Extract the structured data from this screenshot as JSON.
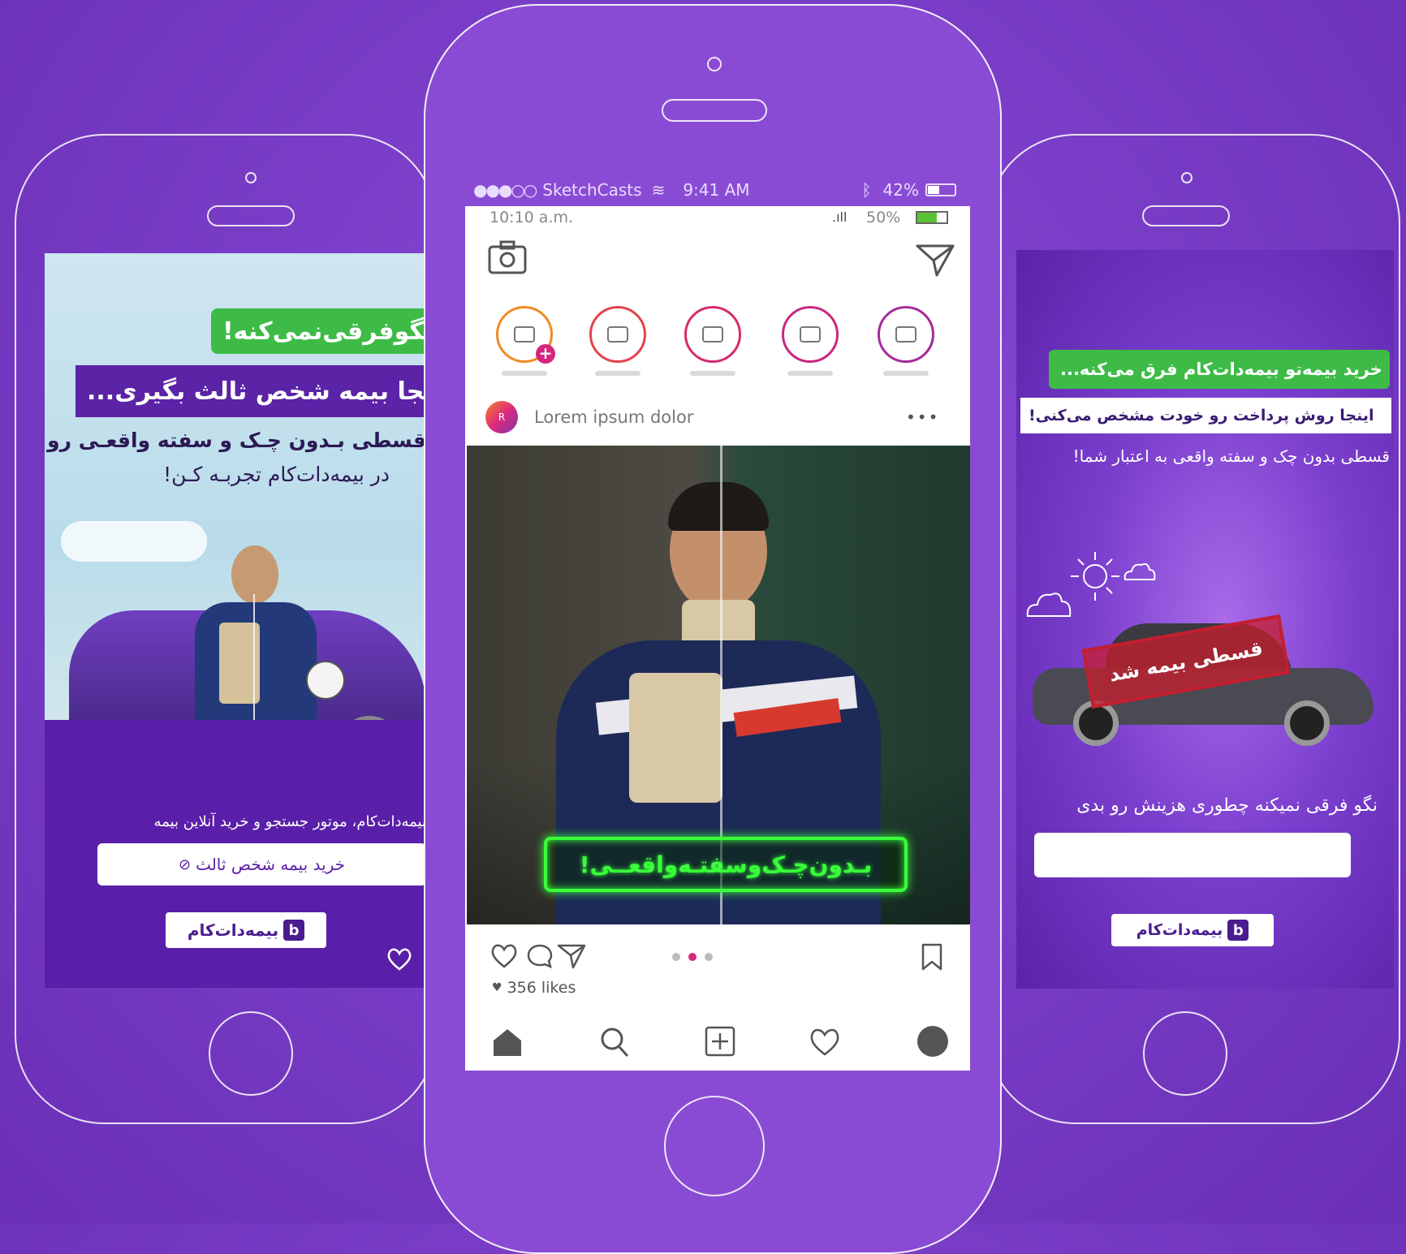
{
  "colors": {
    "background": "#7a3ec8",
    "accent_green": "#3dbb46",
    "accent_purple": "#5b23a6",
    "neon_green": "#39ff3a",
    "like_red": "#d6267d"
  },
  "left": {
    "green_headline": "نگوفرقی‌نمی‌کنه!",
    "purple_headline": "از کجا بیمه شخص ثالث بگیری...",
    "body_line1": "قسطی بـدون چـک و سفته واقعـی رو",
    "body_line2": "در بیمه‌دات‌کام تجربـه کـن!",
    "footer_text": "بیمه‌دات‌کام، موتور جستجو و خرید آنلاین بیمه",
    "cta": "خرید بیمه شخص ثالث",
    "logo": "بیمه‌دات‌کام",
    "logo_mark": "b",
    "heart_icon": "heart-icon"
  },
  "center": {
    "status_bar": {
      "carrier": "SketchCasts",
      "signal": "●●●○○",
      "time": "9:41 AM",
      "battery": "42%"
    },
    "inner_status": {
      "time": "10:10 a.m.",
      "battery": "50%"
    },
    "stories": [
      {
        "has_plus": true
      },
      {
        "has_plus": false
      },
      {
        "has_plus": false
      },
      {
        "has_plus": false
      },
      {
        "has_plus": false
      }
    ],
    "post": {
      "avatar_letter": "R",
      "username": "Lorem ipsum dolor",
      "more": "•••",
      "neon_caption": "بـدون‌چـک‌وسفتـه‌واقعــی!",
      "likes": "356 likes"
    },
    "icons": [
      "home-icon",
      "search-icon",
      "add-icon",
      "heart-icon",
      "profile-icon"
    ]
  },
  "right": {
    "green_headline": "خرید بیمه‌تو بیمه‌دات‌کام فرق می‌کنه...",
    "white_headline": "اینجا روش پرداخت رو خودت مشخص می‌کنی!",
    "body": "قسطی بدون چک و سفته واقعی به اعتبار شما!",
    "stamp": "قسطی بیمه شد",
    "bottom_text": "نگو فرقی نمیکنه چطوری هزینش رو بدی",
    "logo": "بیمه‌دات‌کام",
    "logo_mark": "b"
  }
}
